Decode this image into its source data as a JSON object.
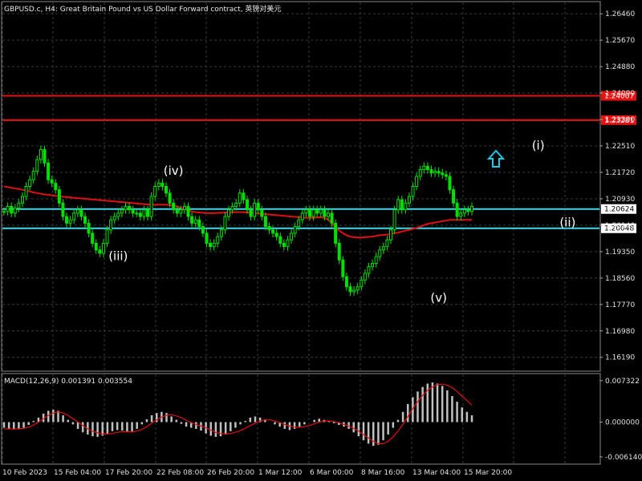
{
  "header": {
    "title": "GBPUSD.c, H4:  Great Britain Pound vs US Dollar Forward contract, 英镑对美元"
  },
  "colors": {
    "background": "#000000",
    "grid": "#3a3a3a",
    "candle": "#00e000",
    "ma": "#e01010",
    "hline_red": "#e81010",
    "hline_cyan": "#40d8e8",
    "macd_hist": "#c0c0c0",
    "macd_signal": "#e01010",
    "arrow": "#20c8e8"
  },
  "chart_data": [
    {
      "type": "candlestick",
      "title": "GBPUSD.c, H4:  Great Britain Pound vs US Dollar Forward contract, 英镑对美元",
      "ylim": [
        1.158,
        1.268
      ],
      "y_ticks": [
        "1.26460",
        "1.25670",
        "1.24880",
        "1.24090",
        "1.23300",
        "1.22510",
        "1.21720",
        "1.20930",
        "1.20140",
        "1.19350",
        "1.18560",
        "1.17770",
        "1.16980",
        "1.16190"
      ],
      "x_ticks": [
        "10 Feb 2023",
        "15 Feb 04:00",
        "17 Feb 20:00",
        "22 Feb 08:00",
        "26 Feb 20:00",
        "1 Mar 12:00",
        "6 Mar 00:00",
        "8 Mar 16:00",
        "13 Mar 04:00",
        "15 Mar 20:00"
      ],
      "close_series": [
        1.2055,
        1.207,
        1.205,
        1.2065,
        1.208,
        1.21,
        1.213,
        1.215,
        1.2175,
        1.221,
        1.224,
        1.22,
        1.215,
        1.214,
        1.212,
        1.208,
        1.204,
        1.202,
        1.203,
        1.205,
        1.206,
        1.204,
        1.202,
        1.199,
        1.196,
        1.194,
        1.193,
        1.196,
        1.2,
        1.203,
        1.204,
        1.205,
        1.206,
        1.207,
        1.206,
        1.205,
        1.205,
        1.204,
        1.206,
        1.204,
        1.21,
        1.213,
        1.214,
        1.213,
        1.211,
        1.208,
        1.206,
        1.205,
        1.206,
        1.207,
        1.204,
        1.202,
        1.203,
        1.201,
        1.199,
        1.196,
        1.195,
        1.196,
        1.198,
        1.2,
        1.204,
        1.206,
        1.207,
        1.208,
        1.211,
        1.209,
        1.206,
        1.204,
        1.208,
        1.206,
        1.204,
        1.201,
        1.2,
        1.199,
        1.198,
        1.196,
        1.195,
        1.197,
        1.199,
        1.201,
        1.203,
        1.205,
        1.206,
        1.204,
        1.206,
        1.205,
        1.206,
        1.204,
        1.205,
        1.202,
        1.196,
        1.191,
        1.186,
        1.183,
        1.1815,
        1.182,
        1.183,
        1.185,
        1.187,
        1.189,
        1.19,
        1.192,
        1.194,
        1.195,
        1.197,
        1.2,
        1.206,
        1.209,
        1.206,
        1.208,
        1.21,
        1.213,
        1.216,
        1.218,
        1.219,
        1.218,
        1.217,
        1.2175,
        1.217,
        1.2165,
        1.216,
        1.212,
        1.208,
        1.204,
        1.205,
        1.206,
        1.2055,
        1.207
      ],
      "ma_series": [
        1.213,
        1.2128,
        1.2126,
        1.2124,
        1.2122,
        1.212,
        1.2118,
        1.2115,
        1.2112,
        1.211,
        1.2108,
        1.2106,
        1.2105,
        1.2103,
        1.2102,
        1.21,
        1.2099,
        1.2098,
        1.2097,
        1.2096,
        1.2095,
        1.2094,
        1.2093,
        1.2092,
        1.2091,
        1.209,
        1.2089,
        1.2088,
        1.2087,
        1.2086,
        1.2085,
        1.2084,
        1.2083,
        1.2082,
        1.2081,
        1.208,
        1.2079,
        1.2078,
        1.2077,
        1.2076,
        1.2075,
        1.2075,
        1.2075,
        1.2075,
        1.2075,
        1.2074,
        1.2072,
        1.207,
        1.2066,
        1.2062,
        1.2058,
        1.2055,
        1.2053,
        1.2052,
        1.2051,
        1.205,
        1.205,
        1.205,
        1.2051,
        1.2051,
        1.2052,
        1.2052,
        1.2053,
        1.2053,
        1.2053,
        1.2053,
        1.2052,
        1.2051,
        1.205,
        1.2049,
        1.2048,
        1.2047,
        1.2046,
        1.2045,
        1.2044,
        1.2043,
        1.2042,
        1.2041,
        1.204,
        1.2039,
        1.2038,
        1.2037,
        1.2036,
        1.2036,
        1.2036,
        1.2037,
        1.2038,
        1.2036,
        1.203,
        1.202,
        1.2008,
        1.1998,
        1.199,
        1.1984,
        1.198,
        1.1978,
        1.1977,
        1.1977,
        1.1978,
        1.1979,
        1.198,
        1.1982,
        1.1984,
        1.1985,
        1.1986,
        1.1988,
        1.199,
        1.1992,
        1.1995,
        1.1998,
        1.2,
        1.2003,
        1.2006,
        1.201,
        1.2014,
        1.2018,
        1.202,
        1.2022,
        1.2024,
        1.2026,
        1.2028,
        1.203,
        1.203,
        1.203,
        1.203,
        1.203,
        1.203,
        1.203
      ],
      "horizontal_lines": [
        {
          "value": "1.24007",
          "color": "red"
        },
        {
          "value": "1.23281",
          "color": "red"
        },
        {
          "value": "1.20624",
          "color": "cyan"
        },
        {
          "value": "1.20048",
          "color": "cyan"
        }
      ],
      "annotations": [
        {
          "label": "(iii)",
          "x_bar": 31,
          "y": 1.191
        },
        {
          "label": "(iv)",
          "x_bar": 46,
          "y": 1.2165
        },
        {
          "label": "(v)",
          "x_bar": 118,
          "y": 1.1785
        },
        {
          "label": "(i)",
          "x_bar": 145,
          "y": 1.224
        },
        {
          "label": "(ii)",
          "x_bar": 153,
          "y": 1.201
        },
        {
          "label": "(iii)",
          "x_bar": 178,
          "y": 1.245
        },
        {
          "label": "(iv)",
          "x_bar": 188,
          "y": 1.231
        }
      ]
    },
    {
      "type": "bar",
      "title": "MACD(12,26,9) 0.001391 0.003554",
      "ylim": [
        -0.007,
        0.008
      ],
      "y_ticks": [
        "0.007322",
        "0.000000",
        "-0.006140"
      ],
      "histogram": [
        -0.001,
        -0.0012,
        -0.0013,
        -0.0012,
        -0.001,
        -0.0005,
        0.0002,
        0.0008,
        0.0015,
        0.002,
        0.0022,
        0.002,
        0.0012,
        0.0004,
        -0.0004,
        -0.0012,
        -0.0018,
        -0.0022,
        -0.0025,
        -0.0026,
        -0.0024,
        -0.002,
        -0.0016,
        -0.0014,
        -0.0015,
        -0.0018,
        -0.0018,
        -0.0012,
        -0.0004,
        0.0005,
        0.0012,
        0.0016,
        0.0018,
        0.0016,
        0.001,
        0.0004,
        -0.0003,
        -0.0008,
        -0.001,
        -0.0012,
        -0.0015,
        -0.002,
        -0.0024,
        -0.0026,
        -0.0025,
        -0.0022,
        -0.0016,
        -0.001,
        -0.0004,
        0.0002,
        0.0008,
        0.001,
        0.0008,
        0.0004,
        0.0,
        -0.0004,
        -0.0008,
        -0.0012,
        -0.0014,
        -0.0012,
        -0.0008,
        -0.0004,
        0.0,
        0.0004,
        0.0006,
        0.0004,
        0.0002,
        -0.0002,
        -0.0005,
        -0.0008,
        -0.0012,
        -0.0018,
        -0.0025,
        -0.0032,
        -0.0038,
        -0.0042,
        -0.004,
        -0.0032,
        -0.0022,
        -0.001,
        0.0004,
        0.0018,
        0.0032,
        0.0044,
        0.0054,
        0.0062,
        0.0068,
        0.007,
        0.0068,
        0.0064,
        0.0056,
        0.0046,
        0.0036,
        0.0026,
        0.0018,
        0.0012
      ],
      "signal": [
        -0.0012,
        -0.0012,
        -0.0012,
        -0.0012,
        -0.0011,
        -0.0009,
        -0.0005,
        0.0,
        0.0006,
        0.0012,
        0.0016,
        0.0018,
        0.0016,
        0.0012,
        0.0006,
        0.0,
        -0.0006,
        -0.0012,
        -0.0016,
        -0.0019,
        -0.0021,
        -0.0021,
        -0.002,
        -0.0018,
        -0.0017,
        -0.0017,
        -0.0017,
        -0.0016,
        -0.0013,
        -0.0008,
        -0.0002,
        0.0004,
        0.0009,
        0.0012,
        0.0013,
        0.0011,
        0.0008,
        0.0003,
        -0.0001,
        -0.0004,
        -0.0007,
        -0.001,
        -0.0014,
        -0.0018,
        -0.002,
        -0.0021,
        -0.002,
        -0.0018,
        -0.0015,
        -0.0011,
        -0.0006,
        -0.0002,
        0.0002,
        0.0004,
        0.0004,
        0.0002,
        -0.0001,
        -0.0004,
        -0.0007,
        -0.0009,
        -0.0009,
        -0.0008,
        -0.0006,
        -0.0003,
        0.0,
        0.0002,
        0.0002,
        0.0001,
        -0.0001,
        -0.0004,
        -0.0007,
        -0.0011,
        -0.0016,
        -0.0022,
        -0.0028,
        -0.0034,
        -0.0038,
        -0.0038,
        -0.0034,
        -0.0026,
        -0.0016,
        -0.0004,
        0.001,
        0.0024,
        0.0036,
        0.0047,
        0.0056,
        0.0062,
        0.0066,
        0.0067,
        0.0065,
        0.0061,
        0.0054,
        0.0046,
        0.0038,
        0.003
      ]
    }
  ]
}
